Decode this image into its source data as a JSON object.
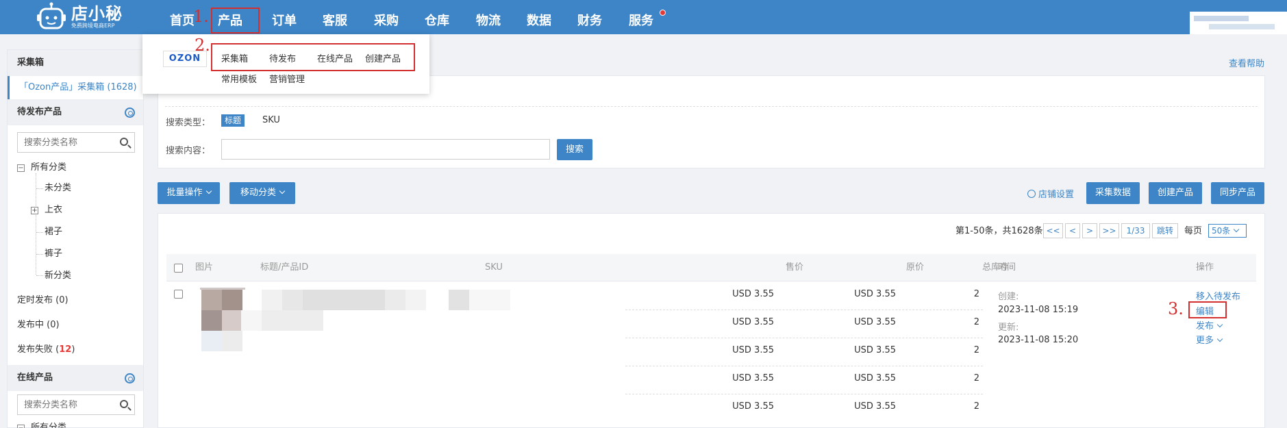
{
  "topbar": {
    "brand_name": "店小秘",
    "brand_tagline": "免费跨境电商ERP",
    "nav": [
      "首页",
      "产品",
      "订单",
      "客服",
      "采购",
      "仓库",
      "物流",
      "数据",
      "财务",
      "服务"
    ],
    "accent": "#3d85c6"
  },
  "dropdown": {
    "logo": "OZON",
    "items": [
      "采集箱",
      "待发布",
      "在线产品",
      "创建产品",
      "常用模板",
      "营销管理"
    ]
  },
  "sidebar": {
    "collect_header": "采集箱",
    "collect_active": "「Ozon产品」采集箱 (1628)",
    "pending_header": "待发布产品",
    "search_placeholder": "搜索分类名称",
    "tree": [
      "所有分类",
      "未分类",
      "上衣",
      "裙子",
      "裤子",
      "新分类"
    ],
    "scheduled": "定时发布 (0)",
    "publishing": "发布中 (0)",
    "failed_label": "发布失败 (",
    "failed_count": "12",
    "failed_close": ")",
    "online_header": "在线产品",
    "online_search_placeholder": "搜索分类名称",
    "online_tree_first": "所有分类"
  },
  "help": "查看帮助",
  "filters": {
    "search_type_label": "搜索类型：",
    "search_type_selected": "标题",
    "search_type_other": "SKU",
    "search_content_label": "搜索内容：",
    "search_button": "搜索"
  },
  "toolbar": {
    "bulk": "批量操作",
    "move": "移动分类",
    "store_settings": "店铺设置",
    "collect": "采集数据",
    "create": "创建产品",
    "sync": "同步产品"
  },
  "pager": {
    "summary": "第1-50条，共1628条",
    "first": "<<",
    "prev": "<",
    "next": ">",
    "last": ">>",
    "page": "1/33",
    "jump": "跳转",
    "per_page_label": "每页",
    "per_page": "50条"
  },
  "table": {
    "headers": [
      "图片",
      "标题/产品ID",
      "SKU",
      "售价",
      "原价",
      "总库存",
      "时间",
      "操作"
    ],
    "variants": [
      {
        "price": "USD 3.55",
        "original": "USD 3.55",
        "stock": "2"
      },
      {
        "price": "USD 3.55",
        "original": "USD 3.55",
        "stock": "2"
      },
      {
        "price": "USD 3.55",
        "original": "USD 3.55",
        "stock": "2"
      },
      {
        "price": "USD 3.55",
        "original": "USD 3.55",
        "stock": "2"
      },
      {
        "price": "USD 3.55",
        "original": "USD 3.55",
        "stock": "2"
      }
    ],
    "created_label": "创建:",
    "created": "2023-11-08 15:19",
    "updated_label": "更新:",
    "updated": "2023-11-08 15:20",
    "actions": {
      "move_pending": "移入待发布",
      "edit": "编辑",
      "publish": "发布",
      "more": "更多"
    }
  },
  "annotations": [
    "1.",
    "2.",
    "3."
  ],
  "annotation_color": "#d32f2f"
}
